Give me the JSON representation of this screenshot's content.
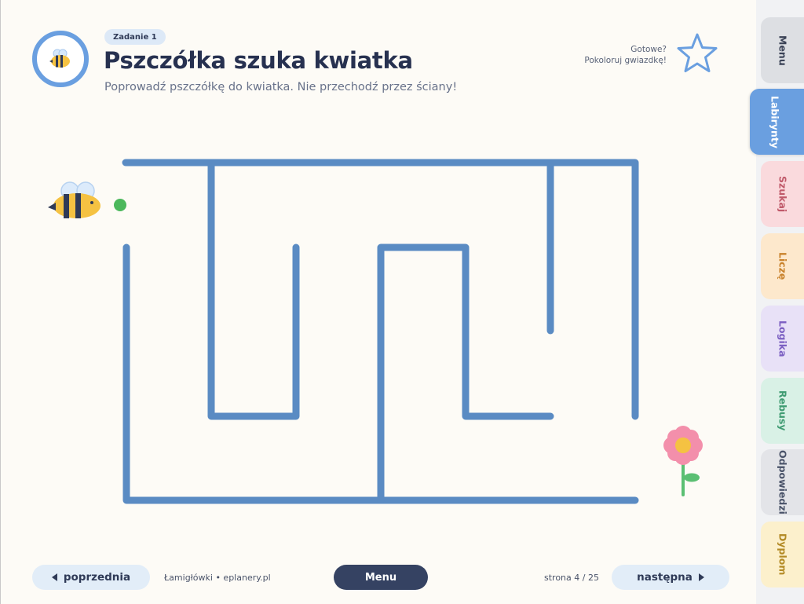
{
  "header": {
    "task_label": "Zadanie 1",
    "title": "Pszczółka szuka kwiatka",
    "subtitle": "Poprowadź pszczółkę do kwiatka. Nie przechodź przez ściany!",
    "ready_line1": "Gotowe?",
    "ready_line2": "Pokoloruj gwiazdkę!"
  },
  "icons": {
    "badge": "bee-icon",
    "star": "star-outline-icon",
    "start": "bee-icon",
    "goal": "flower-icon"
  },
  "colors": {
    "maze_walls": "#5a8bc3",
    "start_dot": "#4cb85c",
    "accent_blue": "#6a9fe0",
    "menu_button": "#354262"
  },
  "footer": {
    "prev_label": "poprzednia",
    "brand": "Łamigłówki • eplanery.pl",
    "menu_label": "Menu",
    "page_info": "strona 4 / 25",
    "next_label": "następna"
  },
  "tabs": [
    {
      "label": "Menu",
      "bg": "#dddfe3",
      "fg": "#3a4256",
      "active": false
    },
    {
      "label": "Labirynty",
      "bg": "#6a9fe0",
      "fg": "#ffffff",
      "active": true
    },
    {
      "label": "Szukaj",
      "bg": "#fadadd",
      "fg": "#c05a6a",
      "active": false
    },
    {
      "label": "Liczę",
      "bg": "#fde8cc",
      "fg": "#c9822c",
      "active": false
    },
    {
      "label": "Logika",
      "bg": "#e8e1f7",
      "fg": "#7b5fc2",
      "active": false
    },
    {
      "label": "Rebusy",
      "bg": "#d9f1e6",
      "fg": "#3f9b72",
      "active": false
    },
    {
      "label": "Odpowiedzi",
      "bg": "#e3e4e8",
      "fg": "#4a5369",
      "active": false
    },
    {
      "label": "Dyplom",
      "bg": "#fcf0cc",
      "fg": "#b38a25",
      "active": false
    }
  ]
}
